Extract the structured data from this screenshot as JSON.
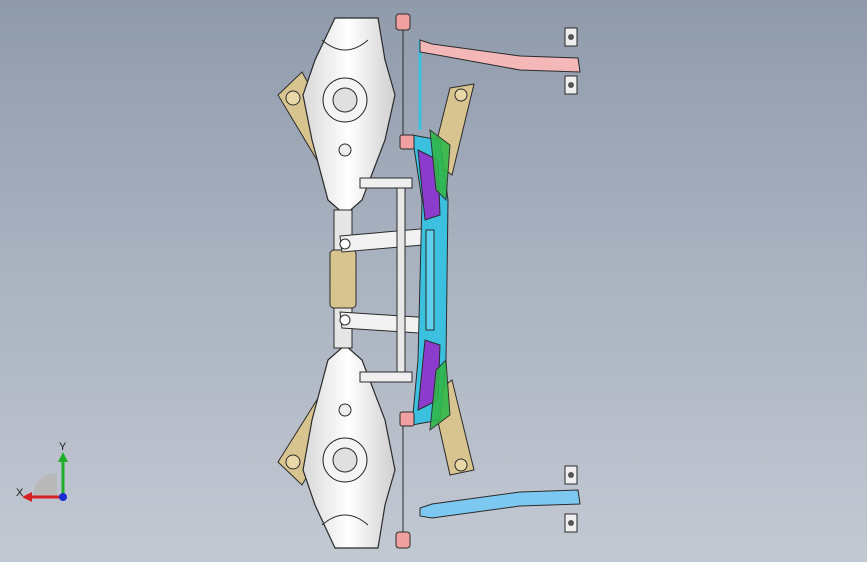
{
  "triad": {
    "x_label": "X",
    "y_label": "Y",
    "x_color": "#d42020",
    "y_color": "#1fae2a",
    "z_color": "#1a2bd1"
  },
  "model": {
    "name_icon": "rear-suspension-subframe-assembly",
    "colors": {
      "trailing_arm": "#efefef",
      "bushing_tan": "#d8c48e",
      "crossmember_cyan": "#3cc0e0",
      "crossmember_purple": "#8c3ccc",
      "bracket_green": "#2fb84a",
      "mount_pink": "#f0a0a0",
      "upper_link_pink": "#f4b8b8",
      "lower_link_blue": "#7cc8f0",
      "outline": "#2a2a2a"
    }
  }
}
